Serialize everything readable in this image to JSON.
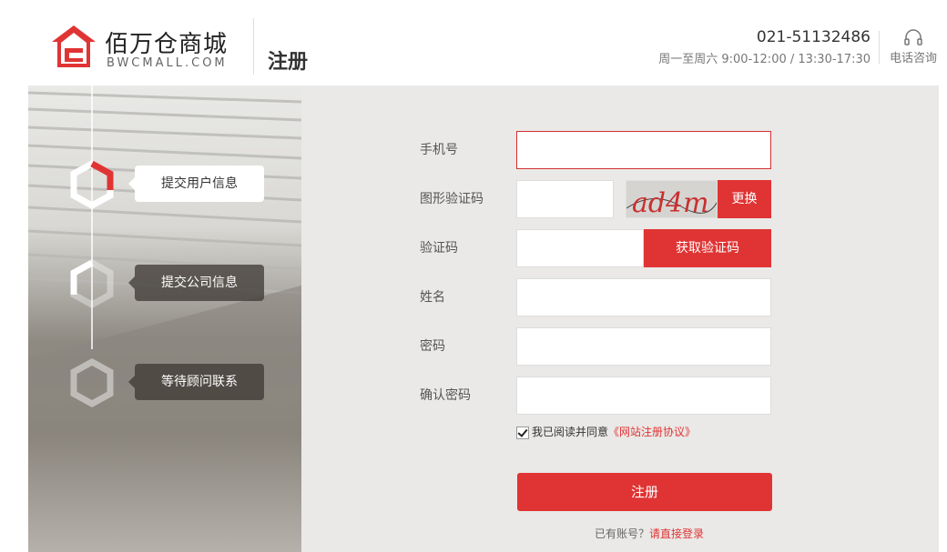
{
  "header": {
    "logo_cn": "佰万仓商城",
    "logo_en": "BWCMALL.COM",
    "page_title": "注册",
    "phone": "021-51132486",
    "hours": "周一至周六 9:00-12:00 / 13:30-17:30",
    "consult_label": "电话咨询",
    "brand_color": "#e03434"
  },
  "steps": [
    {
      "label": "提交用户信息",
      "state": "active"
    },
    {
      "label": "提交公司信息",
      "state": "pending"
    },
    {
      "label": "等待顾问联系",
      "state": "pending"
    }
  ],
  "form": {
    "phone_label": "手机号",
    "phone_value": "",
    "captcha_label": "图形验证码",
    "captcha_value": "",
    "captcha_text": "ad4m",
    "captcha_refresh": "更换",
    "sms_label": "验证码",
    "sms_value": "",
    "sms_button": "获取验证码",
    "name_label": "姓名",
    "name_value": "",
    "password_label": "密码",
    "password_value": "",
    "confirm_label": "确认密码",
    "confirm_value": "",
    "agree_text": "我已阅读并同意",
    "agree_link": "《网站注册协议》",
    "agree_checked": true,
    "submit": "注册",
    "login_tip": "已有账号？",
    "login_link": "请直接登录"
  }
}
